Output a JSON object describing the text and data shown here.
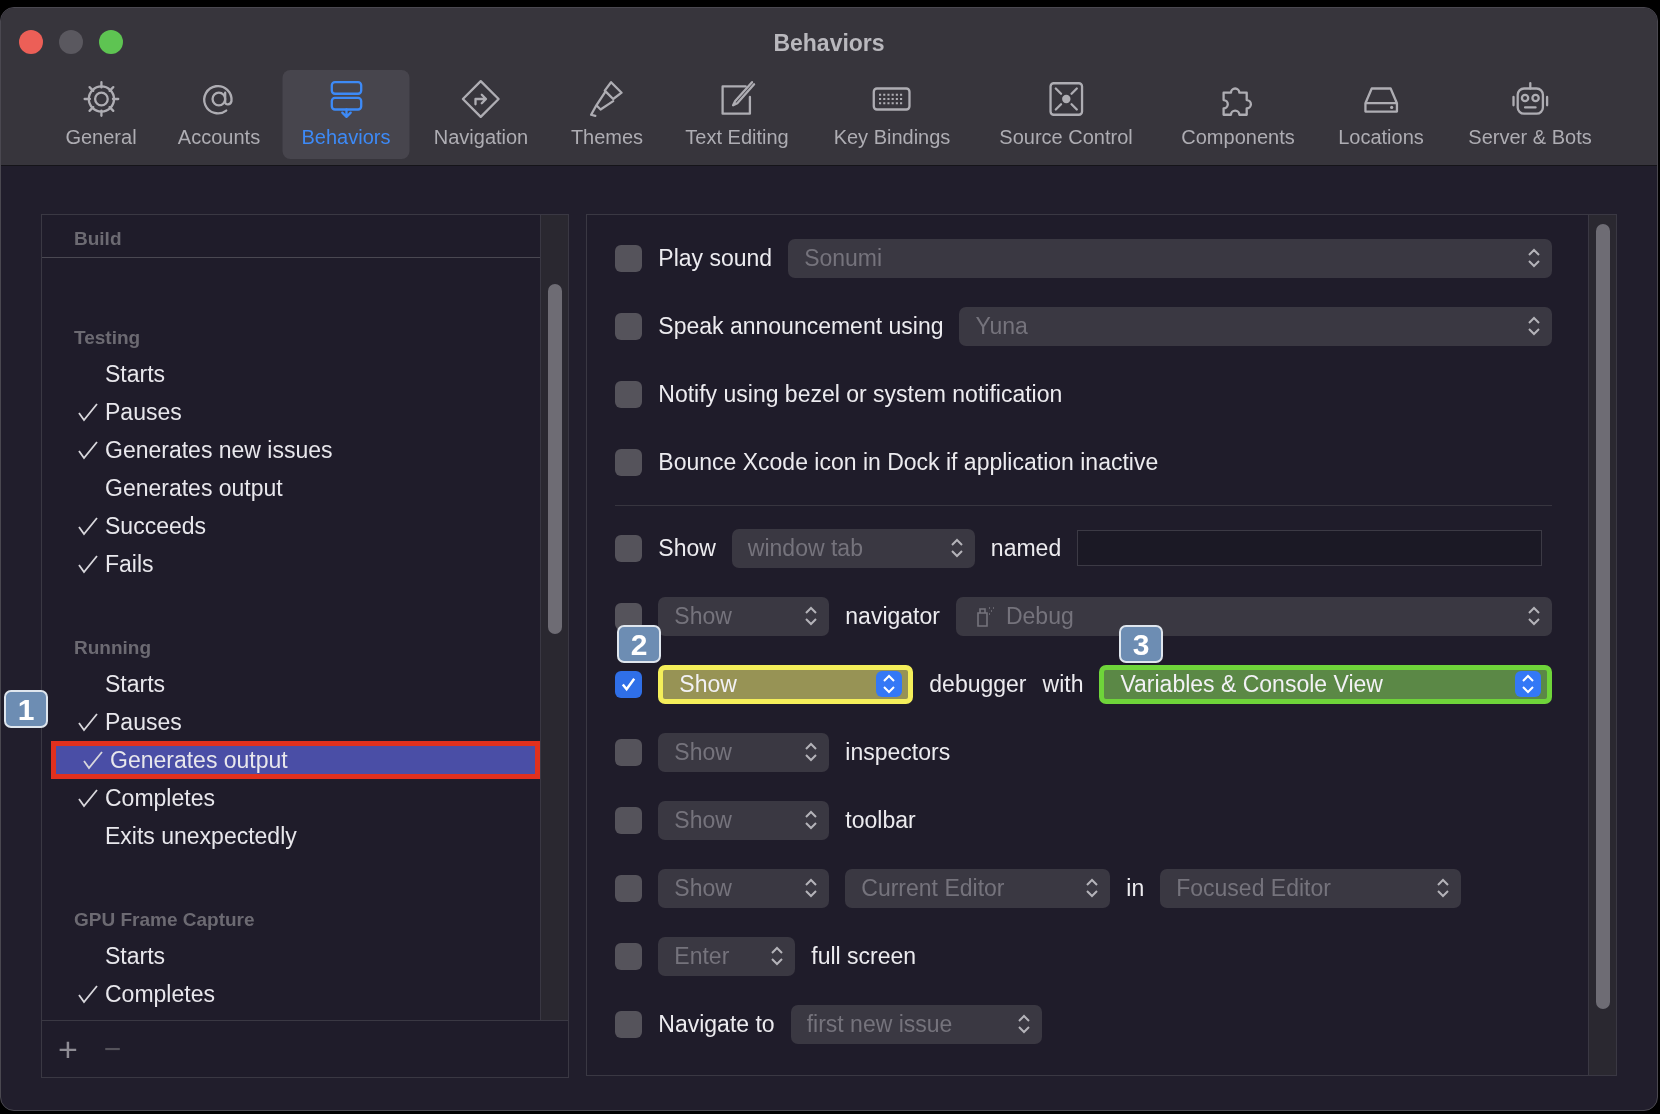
{
  "window": {
    "title": "Behaviors"
  },
  "toolbar": [
    {
      "label": "General",
      "selected": false
    },
    {
      "label": "Accounts",
      "selected": false
    },
    {
      "label": "Behaviors",
      "selected": true
    },
    {
      "label": "Navigation",
      "selected": false
    },
    {
      "label": "Themes",
      "selected": false
    },
    {
      "label": "Text Editing",
      "selected": false
    },
    {
      "label": "Key Bindings",
      "selected": false
    },
    {
      "label": "Source Control",
      "selected": false
    },
    {
      "label": "Components",
      "selected": false
    },
    {
      "label": "Locations",
      "selected": false
    },
    {
      "label": "Server & Bots",
      "selected": false
    }
  ],
  "sidebar": {
    "pinned_header": "Build",
    "groups": [
      {
        "title": "Testing",
        "items": [
          {
            "label": "Starts",
            "checked": false,
            "selected": false
          },
          {
            "label": "Pauses",
            "checked": true,
            "selected": false
          },
          {
            "label": "Generates new issues",
            "checked": true,
            "selected": false
          },
          {
            "label": "Generates output",
            "checked": false,
            "selected": false
          },
          {
            "label": "Succeeds",
            "checked": true,
            "selected": false
          },
          {
            "label": "Fails",
            "checked": true,
            "selected": false
          }
        ]
      },
      {
        "title": "Running",
        "items": [
          {
            "label": "Starts",
            "checked": false,
            "selected": false
          },
          {
            "label": "Pauses",
            "checked": true,
            "selected": false
          },
          {
            "label": "Generates output",
            "checked": true,
            "selected": true
          },
          {
            "label": "Completes",
            "checked": true,
            "selected": false
          },
          {
            "label": "Exits unexpectedly",
            "checked": false,
            "selected": false
          }
        ]
      },
      {
        "title": "GPU Frame Capture",
        "items": [
          {
            "label": "Starts",
            "checked": false,
            "selected": false
          },
          {
            "label": "Completes",
            "checked": true,
            "selected": false
          }
        ]
      }
    ],
    "add_button": "+",
    "remove_button": "−"
  },
  "rows": [
    {
      "kind": "option",
      "checked": false,
      "items": [
        {
          "kind": "label",
          "text": "Play sound"
        },
        {
          "kind": "popup",
          "value": "Sonumi",
          "disabled": true
        }
      ]
    },
    {
      "kind": "option",
      "checked": false,
      "items": [
        {
          "kind": "label",
          "text": "Speak announcement using"
        },
        {
          "kind": "popup",
          "value": "Yuna",
          "disabled": true
        }
      ]
    },
    {
      "kind": "option",
      "checked": false,
      "items": [
        {
          "kind": "label",
          "text": "Notify using bezel or system notification"
        }
      ]
    },
    {
      "kind": "option",
      "checked": false,
      "items": [
        {
          "kind": "label",
          "text": "Bounce Xcode icon in Dock if application inactive"
        }
      ]
    },
    {
      "kind": "separator"
    },
    {
      "kind": "option",
      "checked": false,
      "items": [
        {
          "kind": "label",
          "text": "Show"
        },
        {
          "kind": "popup",
          "value": "window tab",
          "disabled": true
        },
        {
          "kind": "label",
          "text": "named"
        },
        {
          "kind": "field"
        }
      ]
    },
    {
      "kind": "option",
      "checked": false,
      "items": [
        {
          "kind": "popup",
          "value": "Show",
          "disabled": true
        },
        {
          "kind": "label",
          "text": "navigator"
        },
        {
          "kind": "popup",
          "value": "Debug",
          "disabled": true,
          "icon": true
        }
      ]
    },
    {
      "kind": "option",
      "checked": true,
      "items": [
        {
          "kind": "popup",
          "value": "Show",
          "disabled": false
        },
        {
          "kind": "label",
          "text": "debugger"
        },
        {
          "kind": "label",
          "text": "with"
        },
        {
          "kind": "popup",
          "value": "Variables & Console View",
          "disabled": false
        }
      ]
    },
    {
      "kind": "option",
      "checked": false,
      "items": [
        {
          "kind": "popup",
          "value": "Show",
          "disabled": true
        },
        {
          "kind": "label",
          "text": "inspectors"
        }
      ]
    },
    {
      "kind": "option",
      "checked": false,
      "items": [
        {
          "kind": "popup",
          "value": "Show",
          "disabled": true
        },
        {
          "kind": "label",
          "text": "toolbar"
        }
      ]
    },
    {
      "kind": "option",
      "checked": false,
      "items": [
        {
          "kind": "popup",
          "value": "Show",
          "disabled": true
        },
        {
          "kind": "popup",
          "value": "Current Editor",
          "disabled": true
        },
        {
          "kind": "label",
          "text": "in"
        },
        {
          "kind": "popup",
          "value": "Focused Editor",
          "disabled": true
        }
      ]
    },
    {
      "kind": "option",
      "checked": false,
      "items": [
        {
          "kind": "popup",
          "value": "Enter",
          "disabled": true
        },
        {
          "kind": "label",
          "text": "full screen"
        }
      ]
    },
    {
      "kind": "option",
      "checked": false,
      "items": [
        {
          "kind": "label",
          "text": "Navigate to"
        },
        {
          "kind": "popup",
          "value": "first new issue",
          "disabled": true
        }
      ]
    }
  ],
  "annotations": [
    {
      "label": "1",
      "color": "#e0301e"
    },
    {
      "label": "2",
      "color": "#f4ee5a"
    },
    {
      "label": "3",
      "color": "#6fd43a"
    }
  ]
}
